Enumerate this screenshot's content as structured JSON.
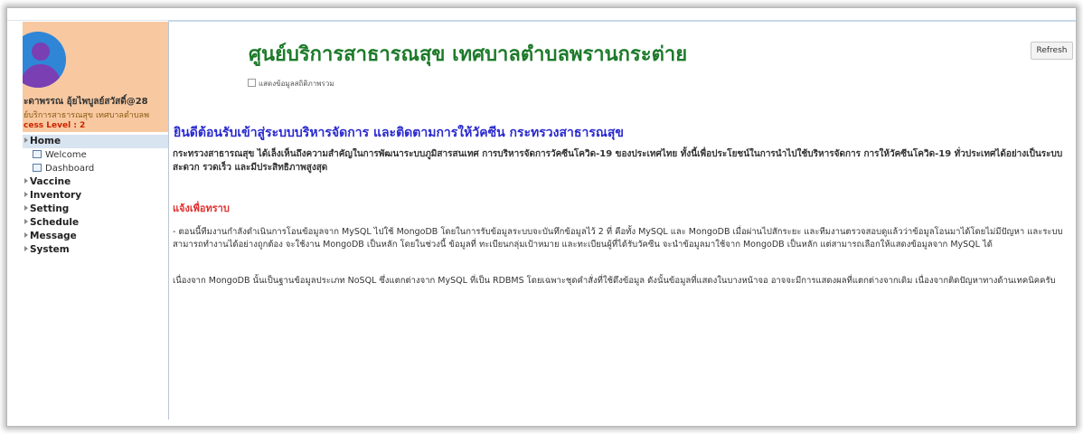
{
  "header": {
    "title": "ศูนย์บริการสาธารณสุข เทศบาลตำบลพรานกระต่าย",
    "refresh_label": "Refresh",
    "checkbox_label": "แสดงข้อมูลสถิติภาพรวม"
  },
  "profile": {
    "name": "ะดาพรรณ อุ้ยไพบูลย์สวัสดิ์@28",
    "org": "ย์บริการสาธารณสุข เทศบาลตำบลพ",
    "level": "cess Level : 2"
  },
  "menu": {
    "home": "Home",
    "welcome": "Welcome",
    "dashboard": "Dashboard",
    "vaccine": "Vaccine",
    "inventory": "Inventory",
    "setting": "Setting",
    "schedule": "Schedule",
    "message": "Message",
    "system": "System"
  },
  "content": {
    "welcome_heading": "ยินดีต้อนรับเข้าสู่ระบบบริหารจัดการ และติดตามการให้วัคซีน กระทรวงสาธารณสุข",
    "intro": "กระทรวงสาธารณสุข ได้เล็งเห็นถึงความสำคัญในการพัฒนาระบบภูมิสารสนเทศ การบริหารจัดการวัคซีนโควิด-19 ของประเทศไทย ทั้งนี้เพื่อประโยชน์ในการนำไปใช้บริหารจัดการ การให้วัคซีนโควิด-19 ทั่วประเทศได้อย่างเป็นระบบ สะดวก รวดเร็ว และมีประสิทธิภาพสูงสุด",
    "notice_heading": "แจ้งเพื่อทราบ",
    "notice_1": "- ตอนนี้ทีมงานกำลังดำเนินการโอนข้อมูลจาก MySQL ไปใช้ MongoDB โดยในการรับข้อมูลระบบจะบันทึกข้อมูลไว้ 2 ที่ คือทั้ง MySQL และ MongoDB เมื่อผ่านไปสักระยะ และทีมงานตรวจสอบดูแล้วว่าข้อมูลโอนมาได้โดยไม่มีปัญหา และระบบสามารถทำงานได้อย่างถูกต้อง จะใช้งาน MongoDB เป็นหลัก โดยในช่วงนี้ ข้อมูลที่ ทะเบียนกลุ่มเป้าหมาย และทะเบียนผู้ที่ได้รับวัคซีน จะนำข้อมูลมาใช้จาก MongoDB เป็นหลัก แต่สามารถเลือกให้แสดงข้อมูลจาก MySQL ได้",
    "notice_2": "เนื่องจาก MongoDB นั้นเป็นฐานข้อมูลประเภท NoSQL ซึ่งแตกต่างจาก MySQL ที่เป็น RDBMS โดยเฉพาะชุดคำสั่งที่ใช้ดึงข้อมูล ดังนั้นข้อมูลที่แสดงในบางหน้าจอ อาจจะมีการแสดงผลที่แตกต่างจากเดิม เนื่องจากติดปัญหาทางด้านเทคนิคครับ"
  },
  "colors": {
    "title": "#1d7a2a",
    "welcome": "#2a2ad0",
    "notice": "#e03030",
    "profile_bg": "#f8c9a1",
    "avatar": "#2f86d6"
  }
}
